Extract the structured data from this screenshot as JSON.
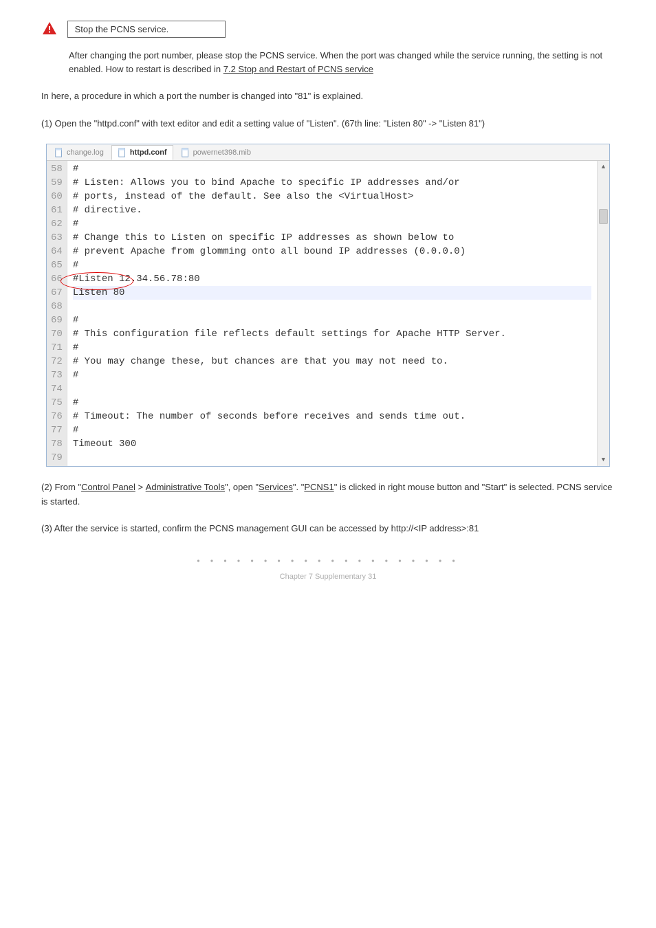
{
  "warn": {
    "box": "Stop the PCNS service.",
    "line1_a": "After changing the port number, please stop the PCNS service. When the port was changed while the service running, the setting is not enabled. How to restart is described in ",
    "line1_link": "7.2 Stop and Restart of PCNS service"
  },
  "intro": "In here, a procedure in which a port the number is changed into \"81\" is explained.",
  "step1": "(1)  Open the \"httpd.conf\" with text editor and edit a setting value of \"Listen\". (67th line: \"Listen 80\" -> \"Listen 81\")",
  "tabs": {
    "t1": "change.log",
    "t2": "httpd.conf",
    "t3": "powernet398.mib"
  },
  "code": {
    "lines": [
      {
        "n": 58,
        "t": "#"
      },
      {
        "n": 59,
        "t": "# Listen: Allows you to bind Apache to specific IP addresses and/or"
      },
      {
        "n": 60,
        "t": "# ports, instead of the default. See also the <VirtualHost>"
      },
      {
        "n": 61,
        "t": "# directive."
      },
      {
        "n": 62,
        "t": "#"
      },
      {
        "n": 63,
        "t": "# Change this to Listen on specific IP addresses as shown below to"
      },
      {
        "n": 64,
        "t": "# prevent Apache from glomming onto all bound IP addresses (0.0.0.0)"
      },
      {
        "n": 65,
        "t": "#"
      },
      {
        "n": 66,
        "t": "#Listen 12.34.56.78:80"
      },
      {
        "n": 67,
        "t": "Listen 80",
        "hl": true
      },
      {
        "n": 68,
        "t": ""
      },
      {
        "n": 69,
        "t": "#"
      },
      {
        "n": 70,
        "t": "# This configuration file reflects default settings for Apache HTTP Server."
      },
      {
        "n": 71,
        "t": "#"
      },
      {
        "n": 72,
        "t": "# You may change these, but chances are that you may not need to."
      },
      {
        "n": 73,
        "t": "#"
      },
      {
        "n": 74,
        "t": ""
      },
      {
        "n": 75,
        "t": "#"
      },
      {
        "n": 76,
        "t": "# Timeout: The number of seconds before receives and sends time out."
      },
      {
        "n": 77,
        "t": "#"
      },
      {
        "n": 78,
        "t": "Timeout 300"
      },
      {
        "n": 79,
        "t": ""
      }
    ]
  },
  "step2": {
    "pre": "(2)  From \"",
    "u1": "Control Panel",
    "mid1": "\" > \"",
    "u2": "Administrative Tools",
    "mid2": "\", open \"",
    "u3": "Services",
    "mid3": "\". \"",
    "u4": "PCNS1",
    "post": "\" is clicked in right mouse button and \"Start\" is selected. PCNS service is started."
  },
  "step3": "(3)  After the service is started, confirm the PCNS management GUI can be accessed by http://<IP address>:81",
  "chapter": "Chapter 7  Supplementary    31"
}
